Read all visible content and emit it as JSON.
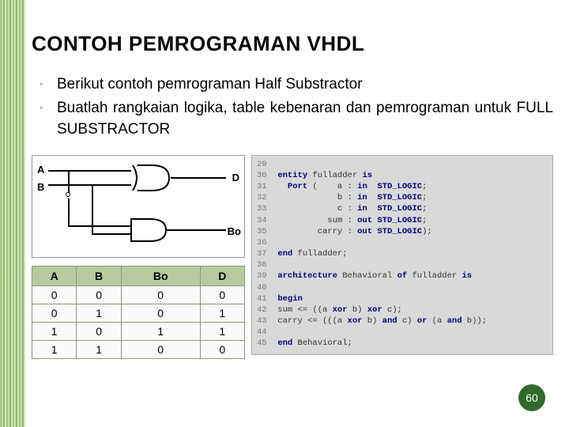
{
  "title": "CONTOH PEMROGRAMAN VHDL",
  "bullets": [
    "Berikut contoh pemrograman Half Substractor",
    "Buatlah rangkaian logika, table kebenaran dan pemrograman untuk FULL SUBSTRACTOR"
  ],
  "circuit": {
    "labels": {
      "A": "A",
      "B": "B",
      "D": "D",
      "Bo": "Bo"
    }
  },
  "truth_table": {
    "headers": [
      "A",
      "B",
      "Bo",
      "D"
    ],
    "rows": [
      [
        "0",
        "0",
        "0",
        "0"
      ],
      [
        "0",
        "1",
        "0",
        "1"
      ],
      [
        "1",
        "0",
        "1",
        "1"
      ],
      [
        "1",
        "1",
        "0",
        "0"
      ]
    ]
  },
  "code": {
    "lines": [
      {
        "n": "29",
        "t": ""
      },
      {
        "n": "30",
        "t": "entity fulladder is"
      },
      {
        "n": "31",
        "t": "  Port (    a : in  STD_LOGIC;"
      },
      {
        "n": "32",
        "t": "            b : in  STD_LOGIC;"
      },
      {
        "n": "33",
        "t": "            c : in  STD_LOGIC;"
      },
      {
        "n": "34",
        "t": "          sum : out STD_LOGIC;"
      },
      {
        "n": "35",
        "t": "        carry : out STD_LOGIC);"
      },
      {
        "n": "36",
        "t": ""
      },
      {
        "n": "37",
        "t": "end fulladder;"
      },
      {
        "n": "38",
        "t": ""
      },
      {
        "n": "39",
        "t": "architecture Behavioral of fulladder is"
      },
      {
        "n": "40",
        "t": ""
      },
      {
        "n": "41",
        "t": "begin"
      },
      {
        "n": "42",
        "t": "sum <= ((a xor b) xor c);"
      },
      {
        "n": "43",
        "t": "carry <= (((a xor b) and c) or (a and b));"
      },
      {
        "n": "44",
        "t": ""
      },
      {
        "n": "45",
        "t": "end Behavioral;"
      }
    ]
  },
  "page_number": "60"
}
